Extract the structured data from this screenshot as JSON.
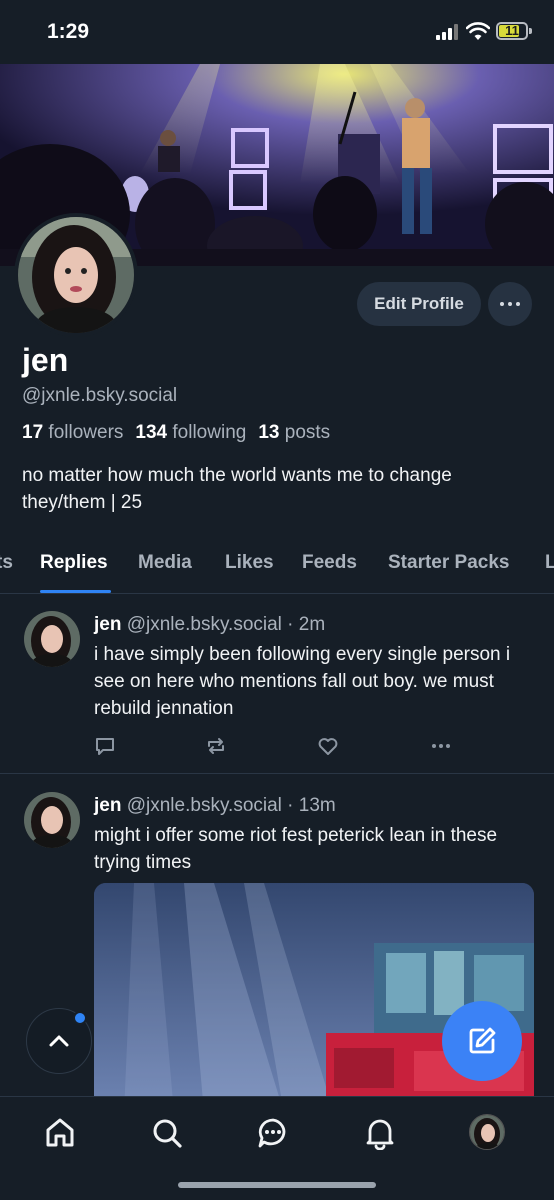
{
  "status_bar": {
    "time": "1:29",
    "battery": "11",
    "battery_level": 0.11
  },
  "profile": {
    "display_name": "jen",
    "handle": "@jxnle.bsky.social",
    "followers_count": "17",
    "followers_label": "followers",
    "following_count": "134",
    "following_label": "following",
    "posts_count": "13",
    "posts_label": "posts",
    "bio_line1": "no matter how much the world wants me to change",
    "bio_line2": "they/them | 25",
    "edit_label": "Edit Profile"
  },
  "tabs": [
    {
      "label": "ts"
    },
    {
      "label": "Replies",
      "active": true
    },
    {
      "label": "Media"
    },
    {
      "label": "Likes"
    },
    {
      "label": "Feeds"
    },
    {
      "label": "Starter Packs"
    },
    {
      "label": "L"
    }
  ],
  "posts": [
    {
      "author": "jen",
      "handle": "@jxnle.bsky.social",
      "time": "· 2m",
      "text": "i have simply been following every single person i see on here who mentions fall out boy. we must rebuild jennation"
    },
    {
      "author": "jen",
      "handle": "@jxnle.bsky.social",
      "time": "· 13m",
      "text": "might i offer some riot fest peterick lean in these trying times"
    }
  ],
  "icons": {
    "reply": "reply-icon",
    "repost": "repost-icon",
    "like": "heart-icon",
    "more": "ellipsis-icon",
    "compose": "compose-icon",
    "scroll_top": "chevron-up-icon",
    "home": "home-icon",
    "search": "search-icon",
    "chat": "chat-icon",
    "notifications": "bell-icon"
  },
  "colors": {
    "background": "#161e27",
    "accent": "#3b82f6",
    "muted": "#aab2bc"
  }
}
